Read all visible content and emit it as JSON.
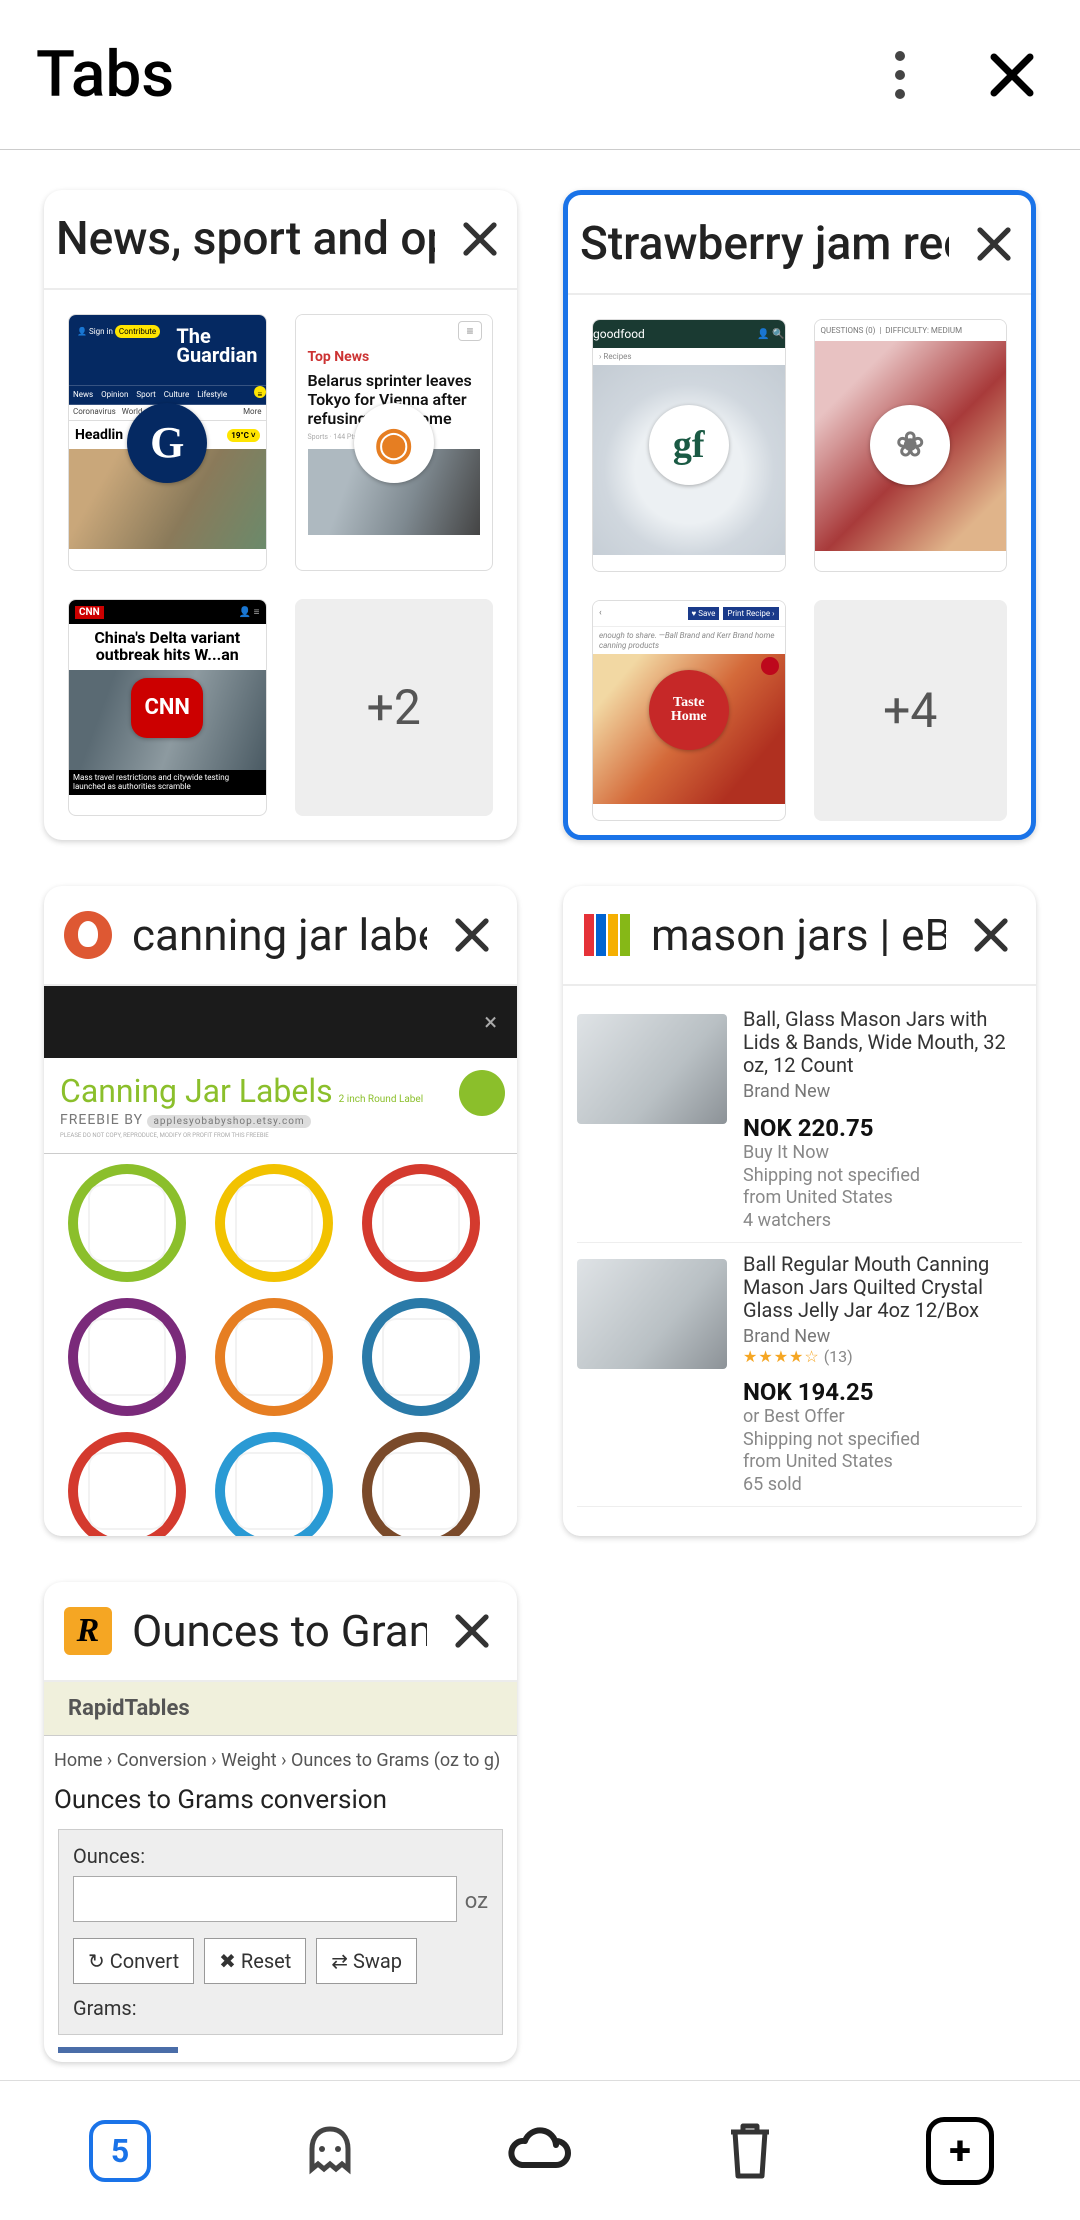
{
  "header": {
    "title": "Tabs"
  },
  "groups": [
    {
      "title": "News, sport and opinion",
      "extra": "+2",
      "thumbs": [
        {
          "badge_bg": "#052962",
          "badge_color": "#fff",
          "badge_text": "G"
        },
        {
          "badge_bg": "#fff",
          "badge_color": "#e67e22",
          "badge_text": "◉"
        },
        {
          "badge_bg": "#cc0000",
          "badge_color": "#fff",
          "badge_text": "CNN"
        }
      ],
      "guardian": {
        "signin": "Sign in",
        "contribute": "Contribute",
        "nav": [
          "News",
          "Opinion",
          "Sport",
          "Culture",
          "Lifestyle"
        ],
        "sub": [
          "Coronavirus",
          "World",
          "More"
        ],
        "headline": "Headlin",
        "weather": "19°C ˅",
        "logo1": "The",
        "logo2": "Guardian"
      },
      "topnews": {
        "label": "Top News",
        "story": "Belarus sprinter leaves Tokyo for Vienna after refusing to go home"
      },
      "cnn": {
        "title": "China's Delta variant outbreak hits W...an",
        "caption": "Mass travel restrictions and citywide testing launched as authorities scramble"
      }
    },
    {
      "title": "Strawberry jam recipes",
      "extra": "+4",
      "selected": true,
      "thumbs": [
        {
          "badge_bg": "#fff",
          "badge_color": "#1a5a44",
          "badge_text": "gf"
        },
        {
          "badge_bg": "#fff",
          "badge_color": "#777",
          "badge_text": "❀"
        },
        {
          "badge_bg": "#c62828",
          "badge_color": "#fff",
          "badge_text": "Taste\nHome"
        }
      ],
      "gf": {
        "brand": "goodfood",
        "crumb": "› Recipes"
      },
      "gf2": {
        "q": "QUESTIONS (0)",
        "diff": "DIFFICULTY: MEDIUM"
      },
      "toh": {
        "save": "♥ Save",
        "btn": "Print Recipe ›",
        "quote": "enough to share. —Ball Brand and Kerr Brand home canning products"
      }
    }
  ],
  "tabs": [
    {
      "title": "canning jar labels",
      "favicon": "ddg",
      "page": {
        "dark_x": "×",
        "title": "Canning Jar Labels",
        "sub": "2 inch Round Label",
        "freebie": "FREEBIE BY",
        "shop": "applesyobabyshop.etsy.com",
        "colors": [
          "#8bbf2b",
          "#f2c200",
          "#d43a2e",
          "#7a2a7a",
          "#e67e22",
          "#2a7aa8",
          "#d43a2e",
          "#2a9ad4",
          "#7a4a2a"
        ]
      }
    },
    {
      "title": "mason jars | eBay",
      "favicon": "ebay",
      "page": {
        "items": [
          {
            "name": "Ball, Glass Mason Jars with Lids &amp; Bands, Wide Mouth, 32 oz, 12 Count",
            "cond": "Brand New",
            "price": "NOK 220.75",
            "lines": [
              "Buy It Now",
              "Shipping not specified",
              "from United States",
              "4 watchers"
            ]
          },
          {
            "name": "Ball Regular Mouth Canning Mason Jars Quilted Crystal Glass Jelly Jar 4oz 12/Box",
            "cond": "Brand New",
            "stars": "★★★★☆",
            "count": "(13)",
            "price": "NOK 194.25",
            "lines": [
              "or Best Offer",
              "Shipping not specified",
              "from United States",
              "65 sold"
            ]
          }
        ]
      }
    },
    {
      "title": "Ounces to Grams",
      "favicon": "rt",
      "page": {
        "brand": "RapidTables",
        "crumb": "Home › Conversion › Weight › Ounces to Grams (oz to g)",
        "h": "Ounces to Grams conversion",
        "l1": "Ounces:",
        "u1": "oz",
        "btns": [
          "↻ Convert",
          "✖ Reset",
          "⇄ Swap"
        ],
        "l2": "Grams:"
      }
    }
  ],
  "bottom": {
    "count": "5"
  }
}
